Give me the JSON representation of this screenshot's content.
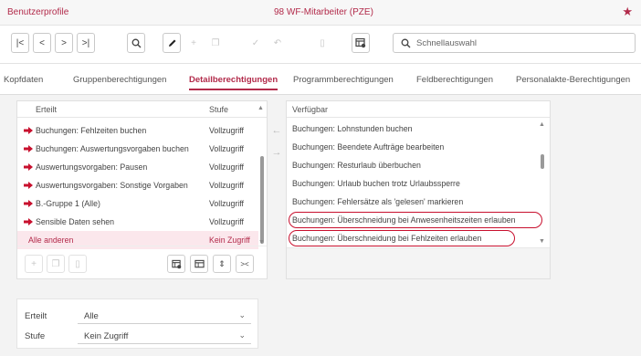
{
  "app": {
    "title": "Benutzerprofile",
    "window_title": "98 WF-Mitarbeiter (PZE)",
    "star_icon": "pin-star-icon"
  },
  "toolbar": {
    "first_label": "|<",
    "prev_label": "<",
    "next_label": ">",
    "last_label": ">|",
    "search_placeholder": "Schnellauswahl"
  },
  "tabs": [
    {
      "label": "Kopfdaten"
    },
    {
      "label": "Gruppenberechtigungen"
    },
    {
      "label": "Detailberechtigungen"
    },
    {
      "label": "Programmberechtigungen"
    },
    {
      "label": "Feldberechtigungen"
    },
    {
      "label": "Personalakte-Berechtigungen"
    }
  ],
  "granted": {
    "header_name": "Erteilt",
    "header_level": "Stufe",
    "rows": [
      {
        "name": "Buchungen: Fehlzeiten buchen",
        "level": "Vollzugriff"
      },
      {
        "name": "Buchungen: Auswertungsvorgaben buchen",
        "level": "Vollzugriff"
      },
      {
        "name": "Auswertungsvorgaben: Pausen",
        "level": "Vollzugriff"
      },
      {
        "name": "Auswertungsvorgaben: Sonstige Vorgaben",
        "level": "Vollzugriff"
      },
      {
        "name": "B.-Gruppe 1 (Alle)",
        "level": "Vollzugriff"
      },
      {
        "name": "Sensible Daten sehen",
        "level": "Vollzugriff"
      },
      {
        "name": "Alle anderen",
        "level": "Kein Zugriff"
      }
    ]
  },
  "available": {
    "header": "Verfügbar",
    "rows": [
      {
        "name": "Buchungen: Lohnstunden buchen"
      },
      {
        "name": "Buchungen: Beendete Aufträge bearbeiten"
      },
      {
        "name": "Buchungen: Resturlaub überbuchen"
      },
      {
        "name": "Buchungen: Urlaub buchen trotz Urlaubssperre"
      },
      {
        "name": "Buchungen: Fehlersätze als 'gelesen' markieren"
      },
      {
        "name": "Buchungen: Überschneidung bei Anwesenheitszeiten erlauben"
      },
      {
        "name": "Buchungen: Überschneidung bei Fehlzeiten erlauben"
      }
    ]
  },
  "filters": {
    "erteilt_label": "Erteilt",
    "erteilt_value": "Alle",
    "stufe_label": "Stufe",
    "stufe_value": "Kein Zugriff"
  },
  "colors": {
    "accent": "#b22a4a",
    "highlight_ring": "#c8102e"
  }
}
